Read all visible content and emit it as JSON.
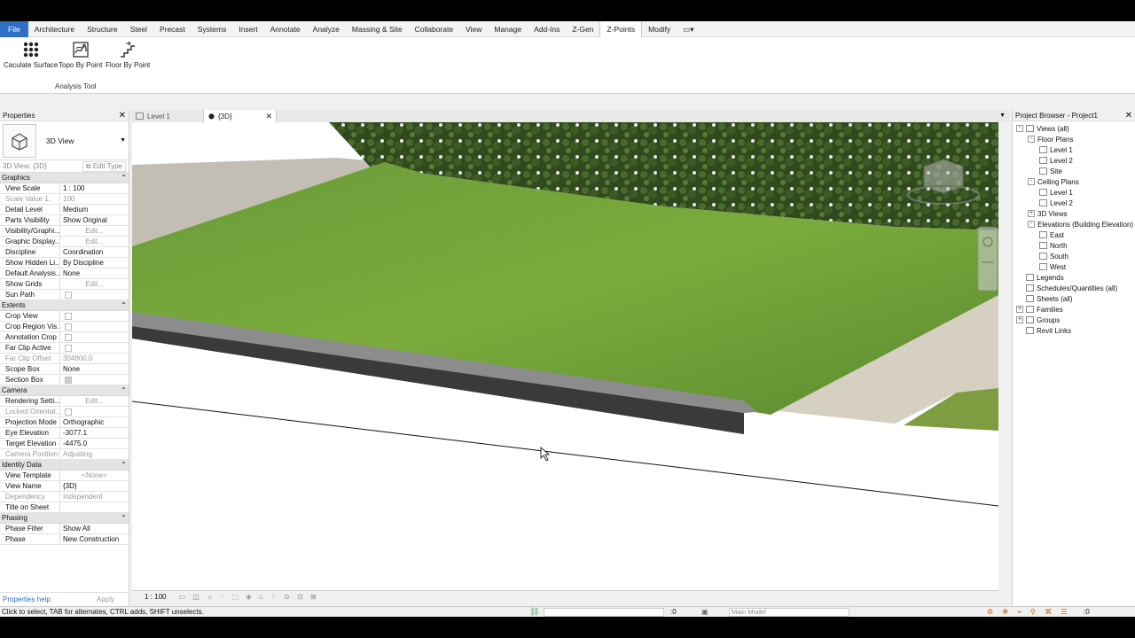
{
  "menu": [
    "File",
    "Architecture",
    "Structure",
    "Steel",
    "Precast",
    "Systems",
    "Insert",
    "Annotate",
    "Analyze",
    "Massing & Site",
    "Collaborate",
    "View",
    "Manage",
    "Add-Ins",
    "Z-Gen",
    "Z-Points",
    "Modify"
  ],
  "active_menu": "Z-Points",
  "ribbon": {
    "buttons": [
      {
        "label": "Caculate Surface",
        "icon": "dot-grid-icon"
      },
      {
        "label": "Topo By Point",
        "icon": "topo-icon"
      },
      {
        "label": "Floor By Point",
        "icon": "stairs-icon"
      }
    ],
    "panel": "Analysis Tool"
  },
  "properties": {
    "title": "Properties",
    "type_name": "3D View",
    "instance": "3D View: {3D}",
    "edit_type": "Edit Type",
    "groups": [
      {
        "name": "Graphics",
        "rows": [
          {
            "k": "View Scale",
            "v": "1 : 100"
          },
          {
            "k": "Scale Value    1:",
            "v": "100",
            "dim": true
          },
          {
            "k": "Detail Level",
            "v": "Medium"
          },
          {
            "k": "Parts Visibility",
            "v": "Show Original"
          },
          {
            "k": "Visibility/Graphi...",
            "v": "Edit...",
            "btn": true
          },
          {
            "k": "Graphic Display...",
            "v": "Edit...",
            "btn": true
          },
          {
            "k": "Discipline",
            "v": "Coordination"
          },
          {
            "k": "Show Hidden Li...",
            "v": "By Discipline"
          },
          {
            "k": "Default Analysis...",
            "v": "None"
          },
          {
            "k": "Show Grids",
            "v": "Edit...",
            "btn": true
          },
          {
            "k": "Sun Path",
            "v": "",
            "chk": true
          }
        ]
      },
      {
        "name": "Extents",
        "rows": [
          {
            "k": "Crop View",
            "v": "",
            "chk": true
          },
          {
            "k": "Crop Region Vis...",
            "v": "",
            "chk": true
          },
          {
            "k": "Annotation Crop",
            "v": "",
            "chk": true
          },
          {
            "k": "Far Clip Active",
            "v": "",
            "chk": true
          },
          {
            "k": "Far Clip Offset",
            "v": "304800.0",
            "dim": true
          },
          {
            "k": "Scope Box",
            "v": "None"
          },
          {
            "k": "Section Box",
            "v": "",
            "chk": true,
            "on": true
          }
        ]
      },
      {
        "name": "Camera",
        "rows": [
          {
            "k": "Rendering Setti...",
            "v": "Edit...",
            "btn": true
          },
          {
            "k": "Locked Orientat...",
            "v": "",
            "chk": true,
            "dim": true
          },
          {
            "k": "Projection Mode",
            "v": "Orthographic"
          },
          {
            "k": "Eye Elevation",
            "v": "-3077.1"
          },
          {
            "k": "Target Elevation",
            "v": "-4475.0"
          },
          {
            "k": "Camera Position",
            "v": "Adjusting",
            "dim": true
          }
        ]
      },
      {
        "name": "Identity Data",
        "rows": [
          {
            "k": "View Template",
            "v": "<None>",
            "btn": true
          },
          {
            "k": "View Name",
            "v": "{3D}"
          },
          {
            "k": "Dependency",
            "v": "Independent",
            "dim": true
          },
          {
            "k": "Title on Sheet",
            "v": ""
          }
        ]
      },
      {
        "name": "Phasing",
        "rows": [
          {
            "k": "Phase Filter",
            "v": "Show All"
          },
          {
            "k": "Phase",
            "v": "New Construction"
          }
        ]
      }
    ],
    "help_link": "Properties help",
    "apply": "Apply"
  },
  "tabs": [
    {
      "label": "Level 1",
      "active": false
    },
    {
      "label": "{3D}",
      "active": true
    }
  ],
  "view_scale": "1 : 100",
  "project_browser": {
    "title": "Project Browser - Project1",
    "tree": [
      {
        "label": "Views (all)",
        "depth": 0,
        "exp": "-"
      },
      {
        "label": "Floor Plans",
        "depth": 1,
        "exp": "-"
      },
      {
        "label": "Level 1",
        "depth": 2
      },
      {
        "label": "Level 2",
        "depth": 2
      },
      {
        "label": "Site",
        "depth": 2
      },
      {
        "label": "Ceiling Plans",
        "depth": 1,
        "exp": "-"
      },
      {
        "label": "Level 1",
        "depth": 2
      },
      {
        "label": "Level 2",
        "depth": 2
      },
      {
        "label": "3D Views",
        "depth": 1,
        "exp": "+"
      },
      {
        "label": "Elevations (Building Elevation)",
        "depth": 1,
        "exp": "-"
      },
      {
        "label": "East",
        "depth": 2
      },
      {
        "label": "North",
        "depth": 2
      },
      {
        "label": "South",
        "depth": 2
      },
      {
        "label": "West",
        "depth": 2
      },
      {
        "label": "Legends",
        "depth": 0
      },
      {
        "label": "Schedules/Quantities (all)",
        "depth": 0
      },
      {
        "label": "Sheets (all)",
        "depth": 0
      },
      {
        "label": "Families",
        "depth": 0,
        "exp": "+"
      },
      {
        "label": "Groups",
        "depth": 0,
        "exp": "+"
      },
      {
        "label": "Revit Links",
        "depth": 0
      }
    ]
  },
  "status": {
    "message": "Click to select, TAB for alternates, CTRL adds, SHIFT unselects.",
    "count": ":0",
    "model": "Main Model",
    "filter": ":0"
  }
}
